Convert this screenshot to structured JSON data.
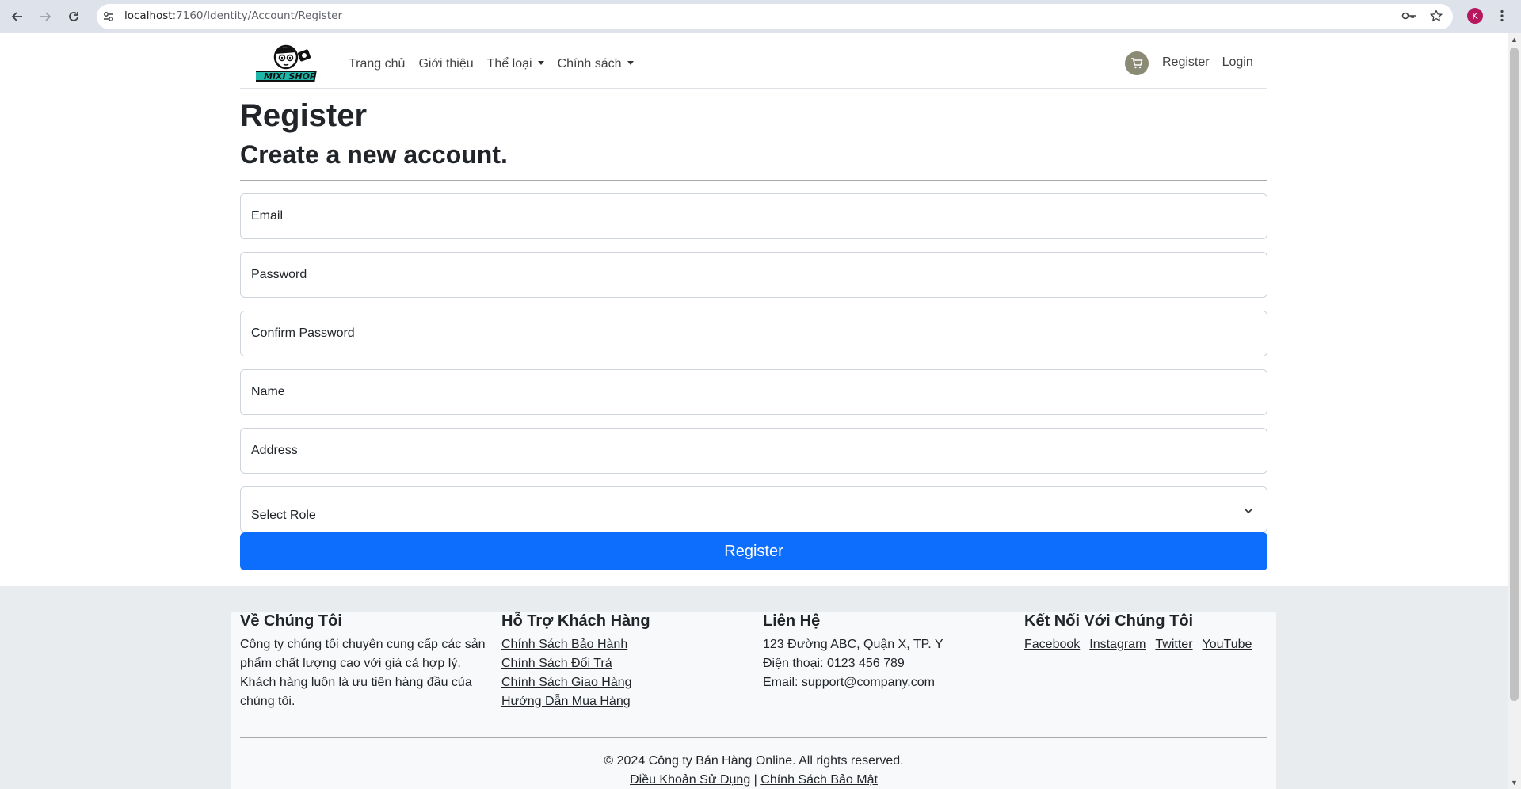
{
  "browser": {
    "url_host": "localhost",
    "url_path": ":7160/Identity/Account/Register",
    "avatar_letter": "K"
  },
  "navbar": {
    "logo_text": "MIXI SHOP",
    "links": [
      "Trang chủ",
      "Giới thiệu",
      "Thể loại",
      "Chính sách"
    ],
    "register": "Register",
    "login": "Login"
  },
  "form": {
    "title": "Register",
    "subtitle": "Create a new account.",
    "email_label": "Email",
    "password_label": "Password",
    "confirm_label": "Confirm Password",
    "name_label": "Name",
    "address_label": "Address",
    "role_label": "Select Role",
    "submit": "Register"
  },
  "footer": {
    "about": {
      "title": "Về Chúng Tôi",
      "text": "Công ty chúng tôi chuyên cung cấp các sản phẩm chất lượng cao với giá cả hợp lý. Khách hàng luôn là ưu tiên hàng đầu của chúng tôi."
    },
    "support": {
      "title": "Hỗ Trợ Khách Hàng",
      "links": [
        "Chính Sách Bảo Hành",
        "Chính Sách Đổi Trả",
        "Chính Sách Giao Hàng",
        "Hướng Dẫn Mua Hàng"
      ]
    },
    "contact": {
      "title": "Liên Hệ",
      "address": "123 Đường ABC, Quận X, TP. Y",
      "phone": "Điện thoại: 0123 456 789",
      "email": "Email: support@company.com"
    },
    "social": {
      "title": "Kết Nối Với Chúng Tôi",
      "links": [
        "Facebook",
        "Instagram",
        "Twitter",
        "YouTube"
      ]
    },
    "copyright": "© 2024 Công ty Bán Hàng Online. All rights reserved.",
    "terms": "Điều Khoản Sử Dụng",
    "separator": "|",
    "privacy": "Chính Sách Bảo Mật"
  }
}
